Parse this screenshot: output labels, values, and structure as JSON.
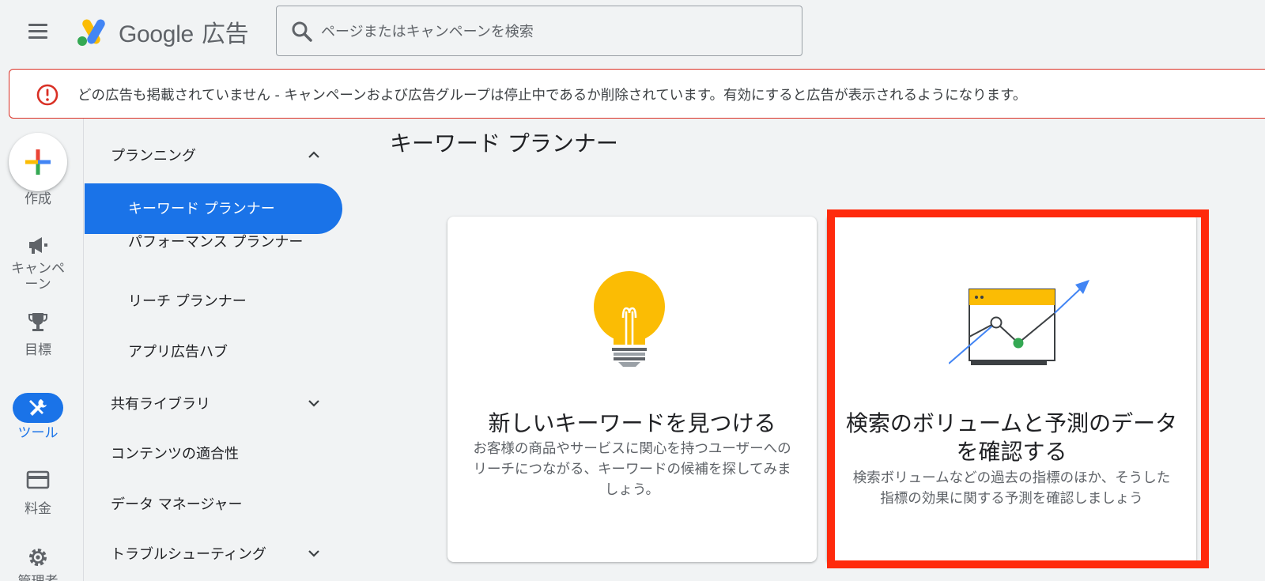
{
  "app": {
    "logo_text": "Google",
    "logo_suffix": "広告"
  },
  "search": {
    "placeholder": "ページまたはキャンペーンを検索"
  },
  "alert": {
    "message": "どの広告も掲載されていません - キャンペーンおよび広告グループは停止中であるか削除されています。有効にすると広告が表示されるようになります。",
    "color": "#d93025"
  },
  "rail": {
    "create_label": "作成",
    "campaigns_label": "キャンペーン",
    "goals_label": "目標",
    "tools_label": "ツール",
    "billing_label": "料金",
    "admin_label": "管理者"
  },
  "sidenav": {
    "planning_group": "プランニング",
    "keyword_planner": "キーワード プランナー",
    "performance_planner": "パフォーマンス プランナー",
    "reach_planner": "リーチ プランナー",
    "app_ads_hub": "アプリ広告ハブ",
    "shared_library": "共有ライブラリ",
    "content_suitability": "コンテンツの適合性",
    "data_manager": "データ マネージャー",
    "troubleshooting": "トラブルシューティング"
  },
  "main": {
    "page_title": "キーワード プランナー",
    "cards": [
      {
        "title": "新しいキーワードを見つける",
        "description": "お客様の商品やサービスに関心を持つユーザーへのリーチにつながる、キーワードの候補を探してみましょう。"
      },
      {
        "title": "検索のボリュームと予測のデータを確認する",
        "description": "検索ボリュームなどの過去の指標のほか、そうした指標の効果に関する予測を確認しましょう"
      }
    ]
  },
  "colors": {
    "accent": "#1a73e8",
    "highlight": "#ff2a0c",
    "bulb": "#fbbc04"
  }
}
